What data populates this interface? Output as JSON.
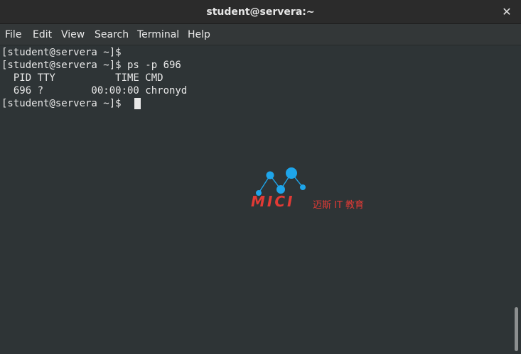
{
  "window": {
    "title": "student@servera:~",
    "close_glyph": "✕"
  },
  "menu": {
    "items": [
      "File",
      "Edit",
      "View",
      "Search",
      "Terminal",
      "Help"
    ]
  },
  "terminal": {
    "lines": [
      "[student@servera ~]$",
      "[student@servera ~]$ ps -p 696",
      "  PID TTY          TIME CMD",
      "  696 ?        00:00:00 chronyd",
      "[student@servera ~]$ "
    ]
  },
  "watermark": {
    "brand": "MICI",
    "subtitle": "迈斯 IT 教育",
    "color": "#e23a35",
    "dot_color": "#1ea5ea"
  }
}
